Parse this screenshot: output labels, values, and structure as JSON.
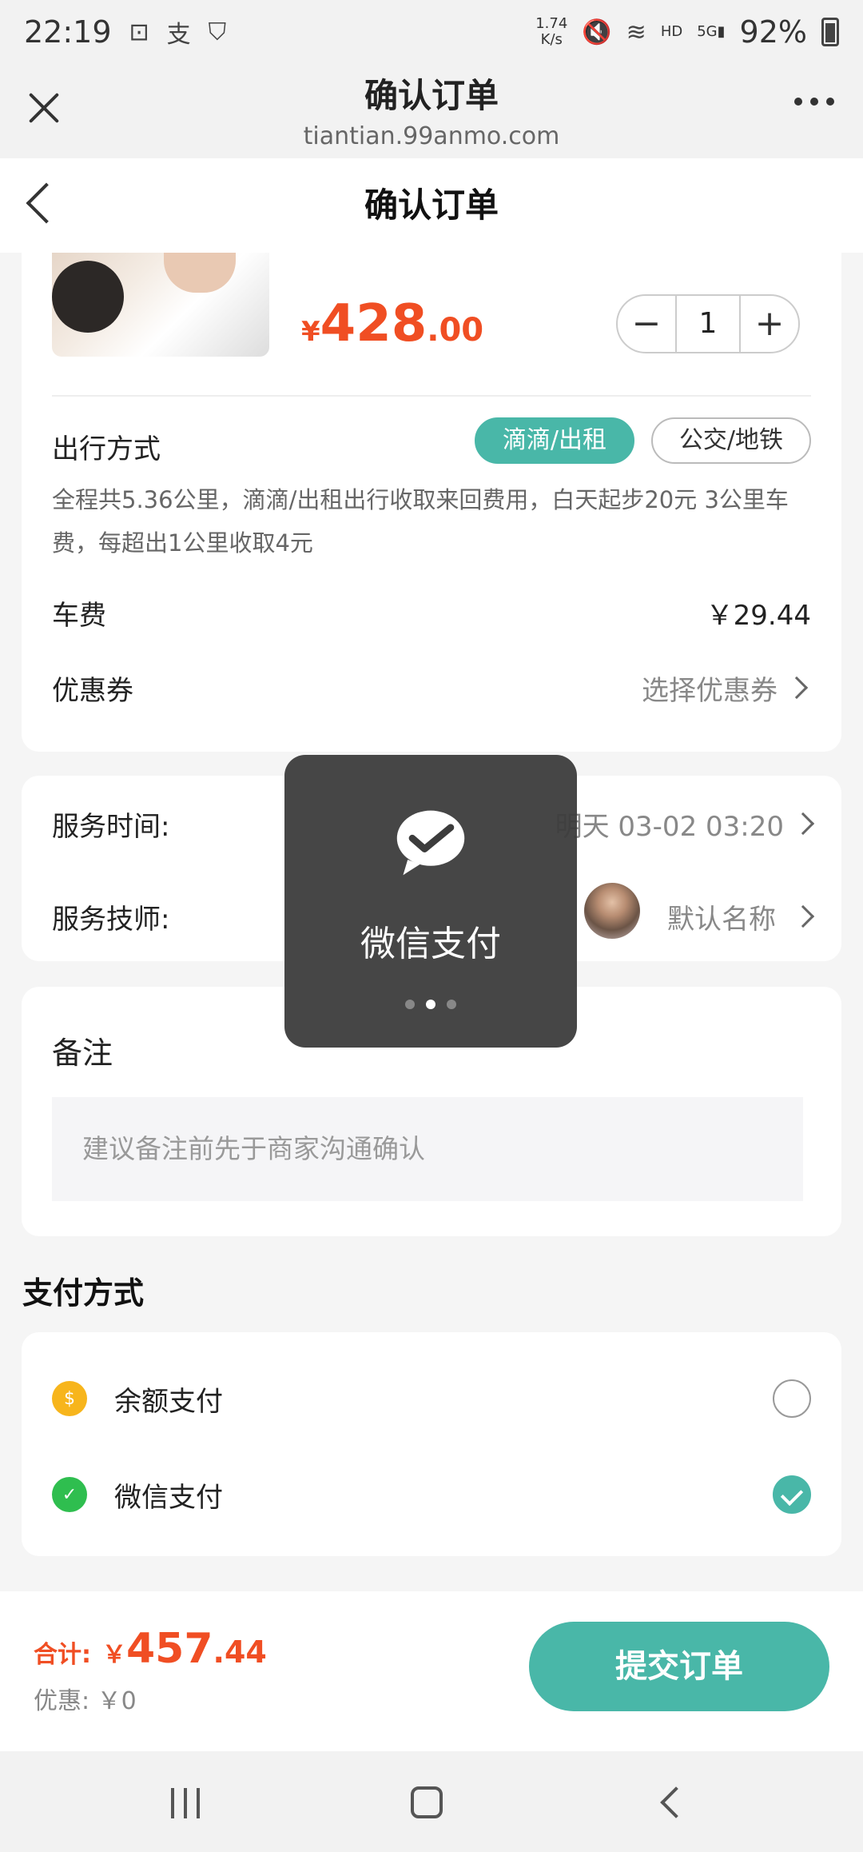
{
  "status_bar": {
    "time": "22:19",
    "net_speed_top": "1.74",
    "net_speed_bottom": "K/s",
    "battery": "92%",
    "icons": [
      "screenshot-icon",
      "alipay-icon",
      "shield-icon",
      "mute-icon",
      "wifi-icon",
      "hd-icon",
      "5g-signal-icon",
      "battery-icon"
    ]
  },
  "browser": {
    "title": "确认订单",
    "url": "tiantian.99anmo.com"
  },
  "header": {
    "title": "确认订单"
  },
  "product": {
    "price_currency": "¥",
    "price_int": "428",
    "price_dec": ".00",
    "quantity": "1"
  },
  "travel": {
    "label": "出行方式",
    "option_active": "滴滴/出租",
    "option_inactive": "公交/地铁",
    "description": "全程共5.36公里，滴滴/出租出行收取来回费用，白天起步20元 3公里车费，每超出1公里收取4元"
  },
  "fare": {
    "label": "车费",
    "value": "￥29.44"
  },
  "coupon": {
    "label": "优惠券",
    "value": "选择优惠券"
  },
  "service": {
    "time_label": "服务时间:",
    "time_value": "明天 03-02 03:20",
    "tech_label": "服务技师:",
    "tech_value": "默认名称"
  },
  "remark": {
    "title": "备注",
    "placeholder": "建议备注前先于商家沟通确认"
  },
  "payment": {
    "title": "支付方式",
    "options": [
      {
        "label": "余额支付",
        "icon": "coin-icon",
        "selected": false
      },
      {
        "label": "微信支付",
        "icon": "wechat-icon",
        "selected": true
      }
    ]
  },
  "bottom": {
    "total_label": "合计:",
    "total_currency": "￥",
    "total_int": "457",
    "total_dec": ".44",
    "discount": "优惠: ￥0",
    "submit": "提交订单"
  },
  "toast": {
    "text": "微信支付",
    "icon": "wechat-pay-icon"
  },
  "colors": {
    "accent": "#49b7a8",
    "price": "#f04e23"
  }
}
